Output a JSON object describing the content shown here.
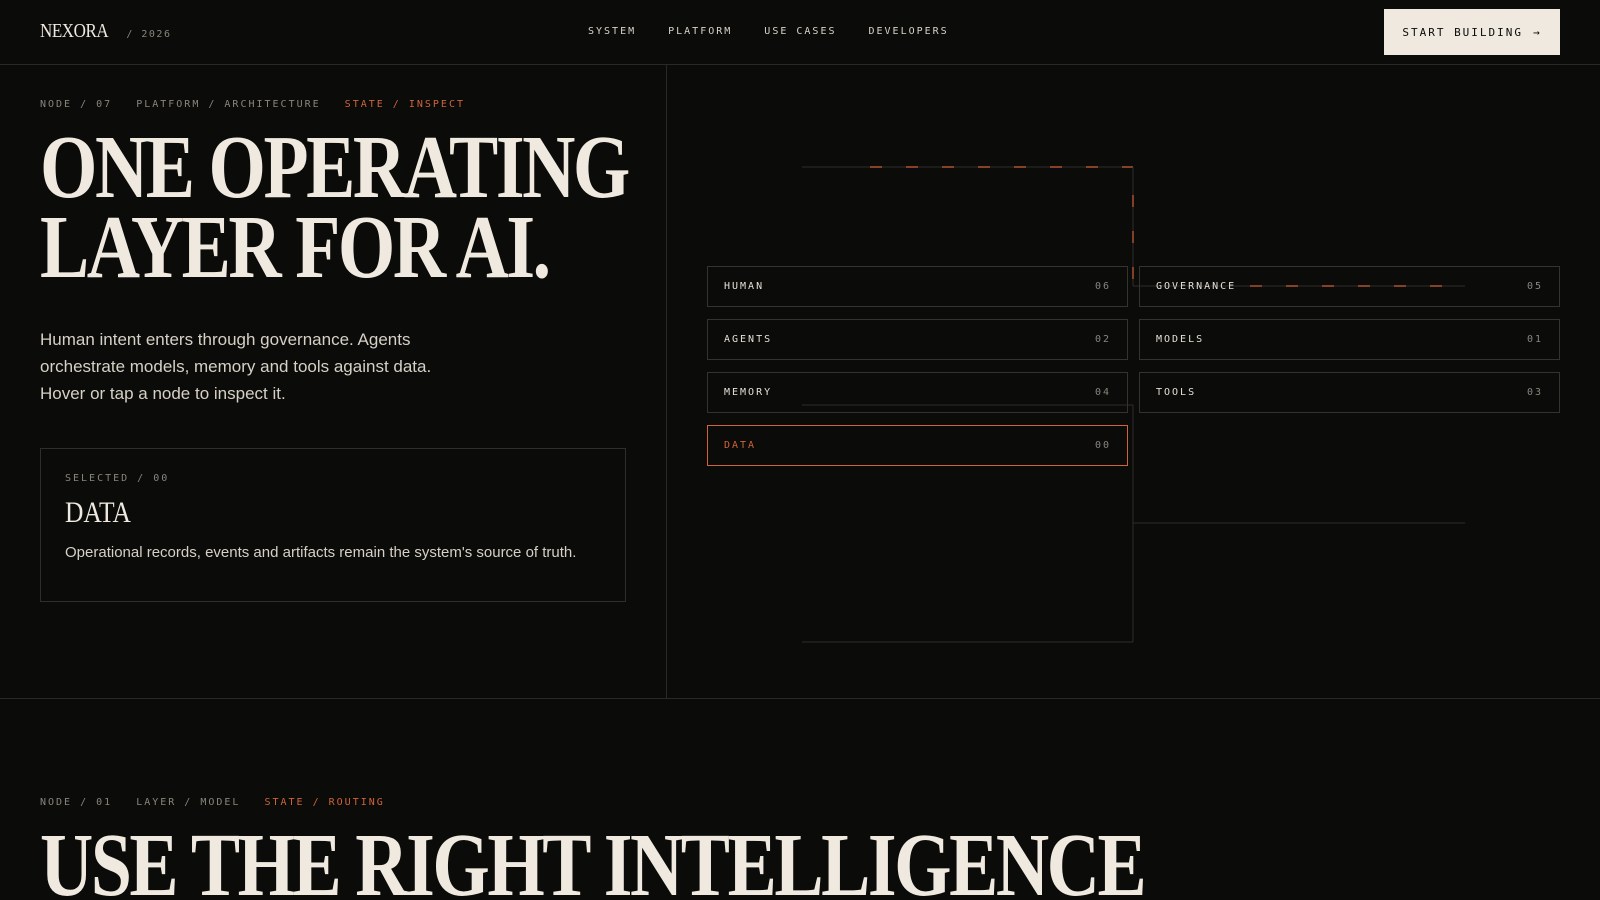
{
  "header": {
    "brand": "NEXORA",
    "year": "/ 2026",
    "nav": [
      "SYSTEM",
      "PLATFORM",
      "USE CASES",
      "DEVELOPERS"
    ],
    "cta_label": "START BUILDING",
    "cta_arrow": "→"
  },
  "hero": {
    "crumbs": [
      "NODE / 07",
      "PLATFORM / ARCHITECTURE"
    ],
    "state": "STATE / INSPECT",
    "title_line1": "ONE OPERATING",
    "title_line2": "LAYER FOR AI.",
    "description": "Human intent enters through governance. Agents orchestrate models, memory and tools against data. Hover or tap a node to inspect it."
  },
  "selected": {
    "label": "SELECTED / 00",
    "title": "DATA",
    "description": "Operational records, events and artifacts remain the system's source of truth."
  },
  "nodes": [
    {
      "label": "HUMAN",
      "num": "06"
    },
    {
      "label": "GOVERNANCE",
      "num": "05"
    },
    {
      "label": "AGENTS",
      "num": "02"
    },
    {
      "label": "MODELS",
      "num": "01"
    },
    {
      "label": "MEMORY",
      "num": "04"
    },
    {
      "label": "TOOLS",
      "num": "03"
    },
    {
      "label": "DATA",
      "num": "00"
    }
  ],
  "colors": {
    "accent": "#d0643a",
    "background": "#0b0b0a",
    "text": "#efe9df"
  },
  "section2": {
    "crumbs": [
      "NODE / 01",
      "LAYER / MODEL"
    ],
    "state": "STATE / ROUTING",
    "title": "USE THE RIGHT INTELLIGENCE"
  }
}
